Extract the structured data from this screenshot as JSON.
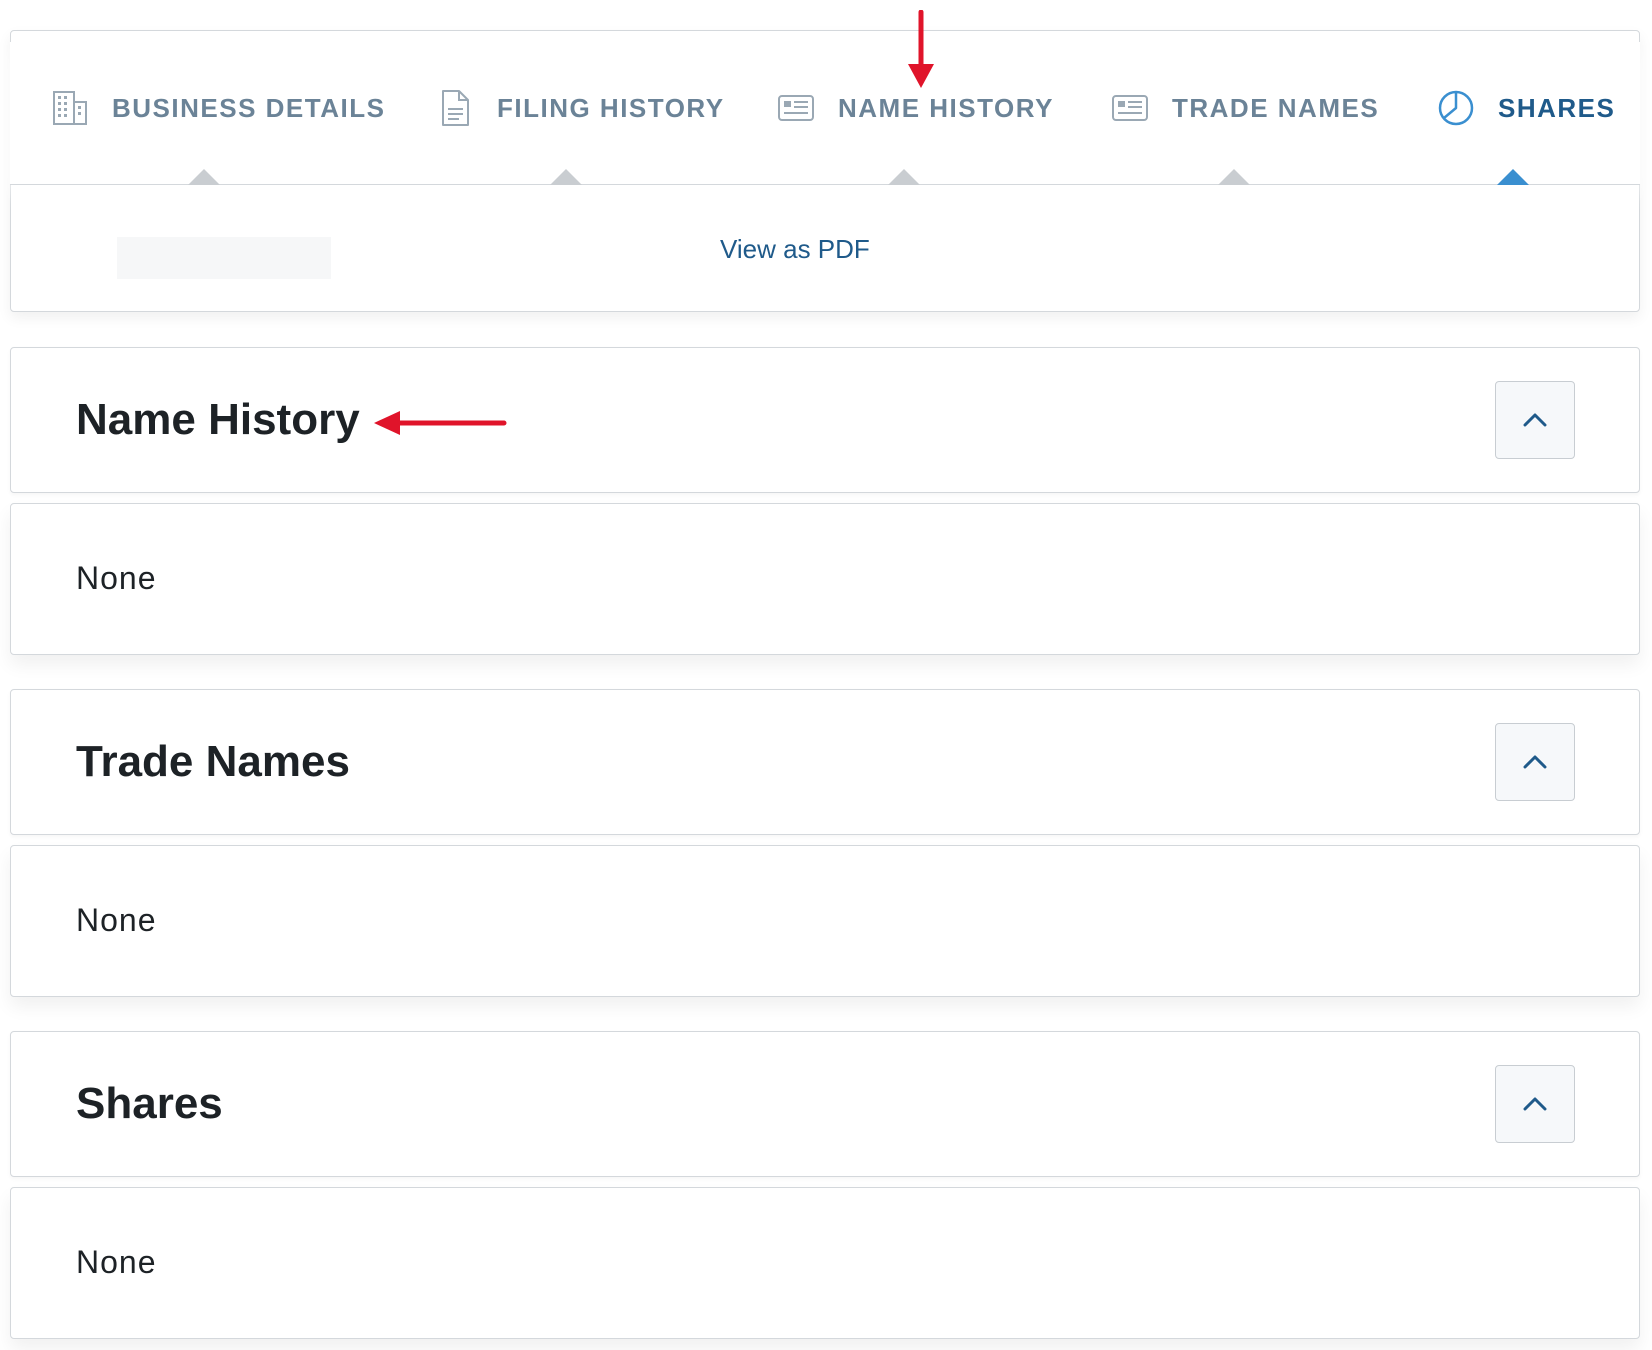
{
  "nav": {
    "items": [
      {
        "label": "BUSINESS DETAILS",
        "icon": "building-icon",
        "active": false
      },
      {
        "label": "FILING HISTORY",
        "icon": "document-icon",
        "active": false
      },
      {
        "label": "NAME HISTORY",
        "icon": "id-card-icon",
        "active": false
      },
      {
        "label": "TRADE NAMES",
        "icon": "id-card-icon",
        "active": false
      },
      {
        "label": "SHARES",
        "icon": "pie-chart-icon",
        "active": true
      }
    ]
  },
  "previous_card": {
    "pdf_link": "View as PDF"
  },
  "sections": [
    {
      "title": "Name History",
      "body": "None"
    },
    {
      "title": "Trade Names",
      "body": "None"
    },
    {
      "title": "Shares",
      "body": "None"
    }
  ],
  "colors": {
    "nav_inactive": "#6b8397",
    "nav_active": "#1f5a8a",
    "active_caret": "#3a8fd0",
    "annotation_arrow": "#e0142a",
    "link": "#1f5a8a"
  }
}
